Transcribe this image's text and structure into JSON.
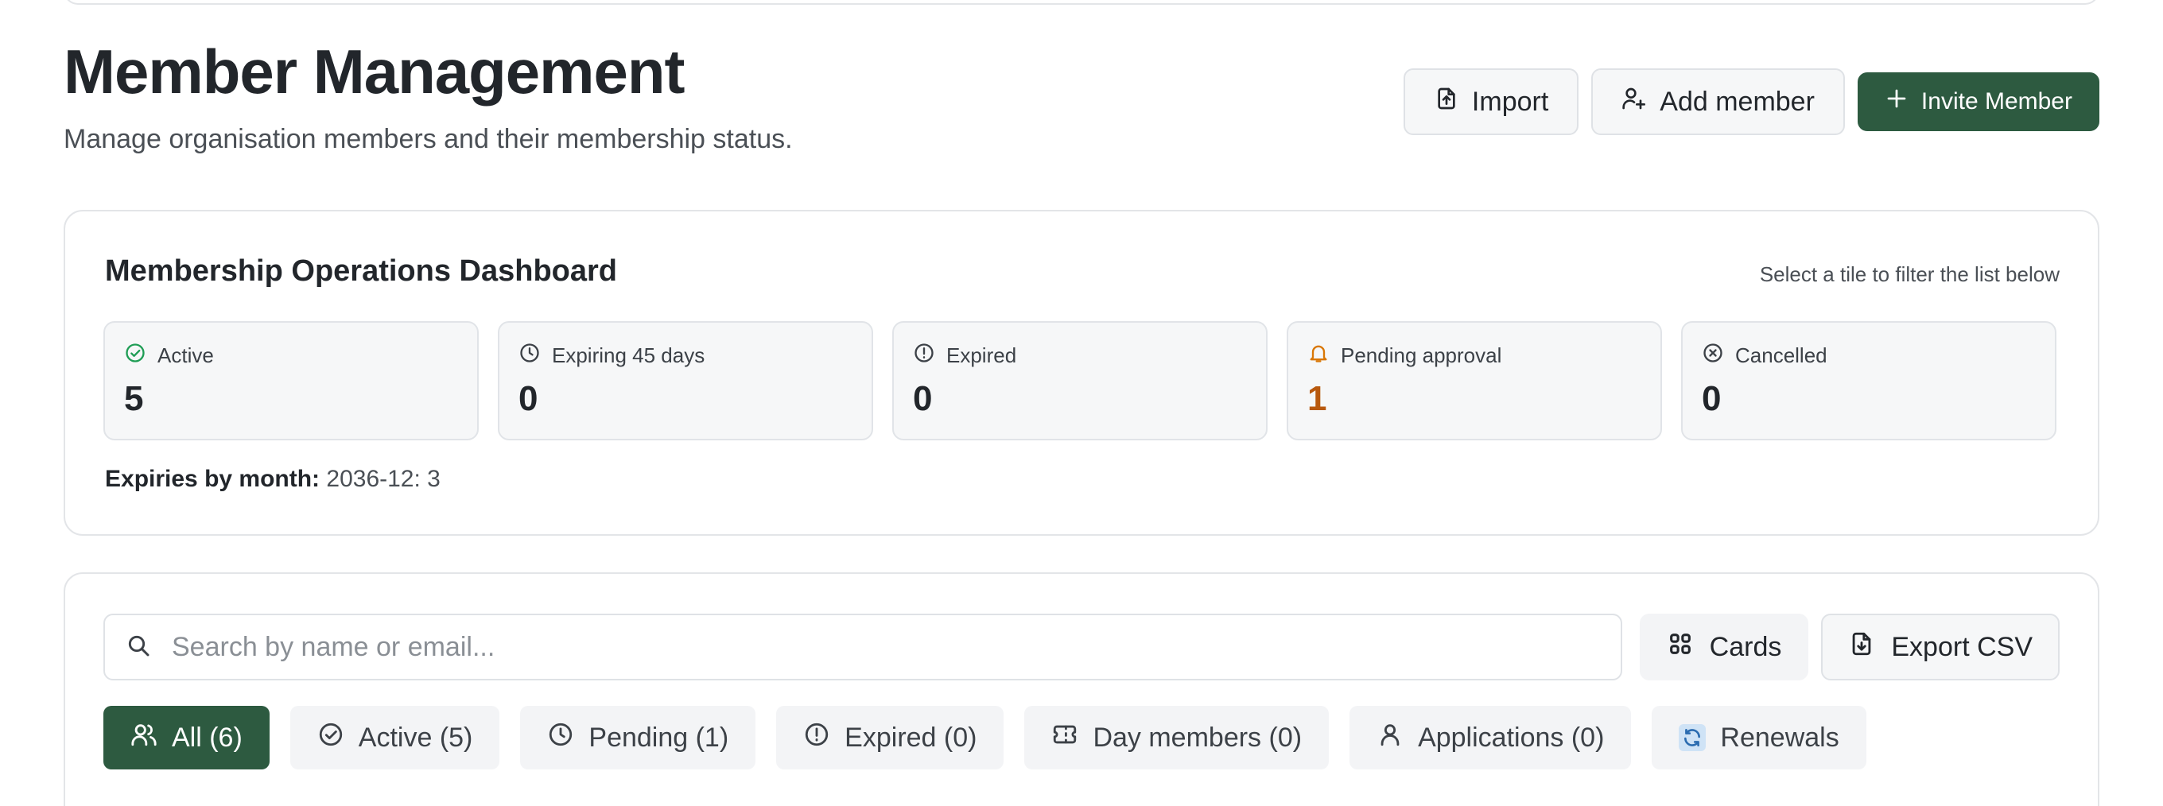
{
  "header": {
    "title": "Member Management",
    "subtitle": "Manage organisation members and their membership status.",
    "actions": {
      "import_label": "Import",
      "add_member_label": "Add member",
      "invite_label": "Invite Member"
    }
  },
  "dashboard": {
    "title": "Membership Operations Dashboard",
    "hint": "Select a tile to filter the list below",
    "tiles": [
      {
        "label": "Active",
        "value": "5",
        "icon": "check-circle-icon",
        "color": "#1f9d55"
      },
      {
        "label": "Expiring 45 days",
        "value": "0",
        "icon": "clock-icon",
        "color": "#3c4147"
      },
      {
        "label": "Expired",
        "value": "0",
        "icon": "alert-circle-icon",
        "color": "#3c4147"
      },
      {
        "label": "Pending approval",
        "value": "1",
        "icon": "bell-icon",
        "color": "#d97706"
      },
      {
        "label": "Cancelled",
        "value": "0",
        "icon": "x-circle-icon",
        "color": "#3c4147"
      }
    ],
    "expiries_label": "Expiries by month:",
    "expiries_value": "2036-12: 3"
  },
  "filters": {
    "search_placeholder": "Search by name or email...",
    "search_value": "",
    "view_label": "Cards",
    "export_label": "Export CSV",
    "tabs": [
      {
        "label": "All (6)",
        "icon": "users-icon",
        "active": true
      },
      {
        "label": "Active (5)",
        "icon": "check-circle-icon",
        "active": false
      },
      {
        "label": "Pending (1)",
        "icon": "clock-icon",
        "active": false
      },
      {
        "label": "Expired (0)",
        "icon": "alert-circle-icon",
        "active": false
      },
      {
        "label": "Day members (0)",
        "icon": "ticket-icon",
        "active": false
      },
      {
        "label": "Applications (0)",
        "icon": "user-icon",
        "active": false
      },
      {
        "label": "Renewals",
        "icon": "refresh-icon",
        "active": false
      }
    ]
  },
  "colors": {
    "primary": "#2d5a40",
    "warning": "#b8590e"
  }
}
